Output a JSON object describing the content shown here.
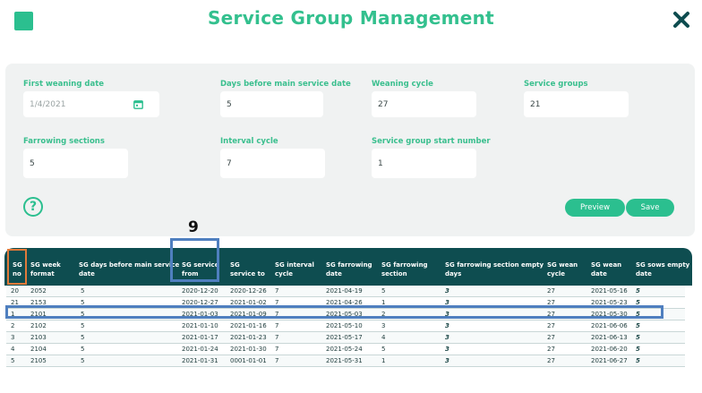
{
  "header": {
    "title": "Service Group Management"
  },
  "form": {
    "first_weaning_date": {
      "label": "First weaning date",
      "value": "1/4/2021"
    },
    "days_before_main_service_date": {
      "label": "Days before main service date",
      "value": "5"
    },
    "weaning_cycle": {
      "label": "Weaning cycle",
      "value": "27"
    },
    "service_groups": {
      "label": "Service groups",
      "value": "21"
    },
    "farrowing_sections": {
      "label": "Farrowing sections",
      "value": "5"
    },
    "interval_cycle": {
      "label": "Interval cycle",
      "value": "7"
    },
    "service_group_start_number": {
      "label": "Service group start number",
      "value": "1"
    }
  },
  "buttons": {
    "help": "?",
    "preview": "Preview",
    "save": "Save"
  },
  "annotation": {
    "number": "9"
  },
  "table": {
    "headers": [
      "SG\nno",
      "SG week\nformat",
      "SG days before main service\ndate",
      "SG service\nfrom",
      "SG\nservice to",
      "SG interval\ncycle",
      "SG farrowing\ndate",
      "SG farrowing\nsection",
      "SG farrowing section empty\ndays",
      "SG wean\ncycle",
      "SG wean\ndate",
      "SG sows empty\ndate"
    ],
    "rows": [
      [
        "20",
        "2052",
        "5",
        "2020-12-20",
        "2020-12-26",
        "7",
        "2021-04-19",
        "5",
        "3",
        "27",
        "2021-05-16",
        "5"
      ],
      [
        "21",
        "2153",
        "5",
        "2020-12-27",
        "2021-01-02",
        "7",
        "2021-04-26",
        "1",
        "3",
        "27",
        "2021-05-23",
        "5"
      ],
      [
        "1",
        "2101",
        "5",
        "2021-01-03",
        "2021-01-09",
        "7",
        "2021-05-03",
        "2",
        "3",
        "27",
        "2021-05-30",
        "5"
      ],
      [
        "2",
        "2102",
        "5",
        "2021-01-10",
        "2021-01-16",
        "7",
        "2021-05-10",
        "3",
        "3",
        "27",
        "2021-06-06",
        "5"
      ],
      [
        "3",
        "2103",
        "5",
        "2021-01-17",
        "2021-01-23",
        "7",
        "2021-05-17",
        "4",
        "3",
        "27",
        "2021-06-13",
        "5"
      ],
      [
        "4",
        "2104",
        "5",
        "2021-01-24",
        "2021-01-30",
        "7",
        "2021-05-24",
        "5",
        "3",
        "27",
        "2021-06-20",
        "5"
      ],
      [
        "5",
        "2105",
        "5",
        "2021-01-31",
        "0001-01-01",
        "7",
        "2021-05-31",
        "1",
        "3",
        "27",
        "2021-06-27",
        "5"
      ]
    ]
  }
}
